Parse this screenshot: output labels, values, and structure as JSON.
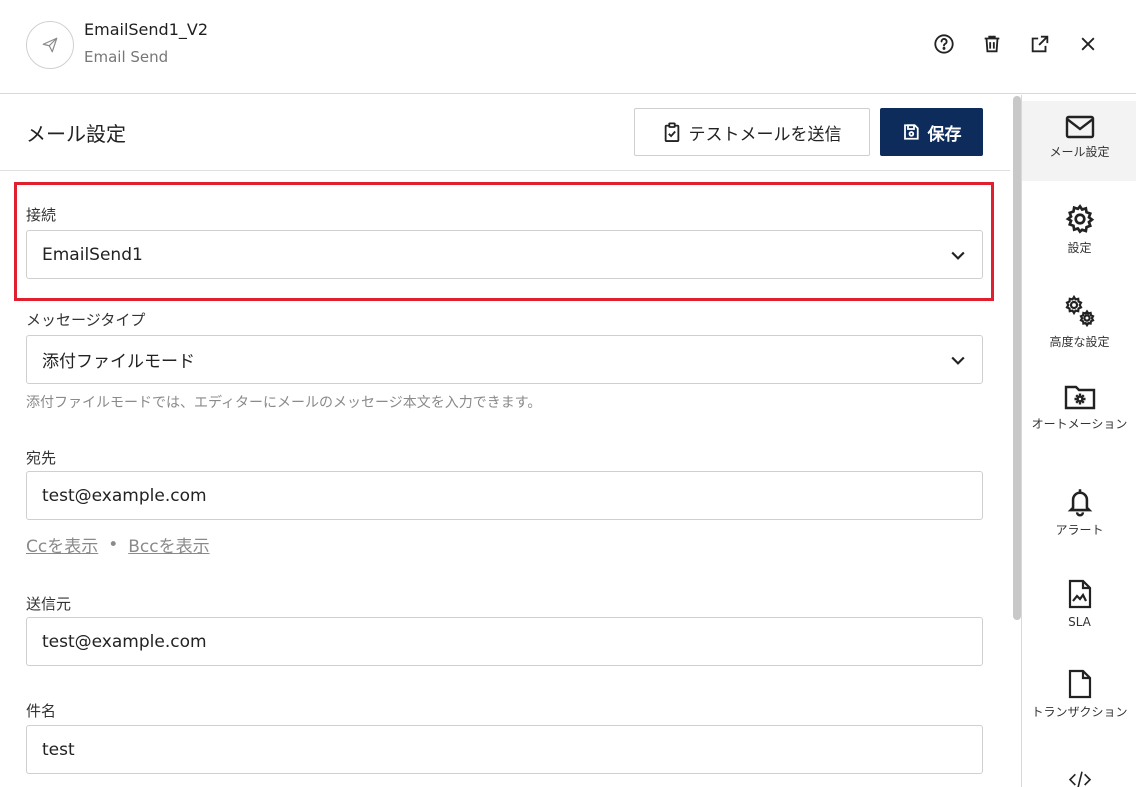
{
  "header": {
    "title": "EmailSend1_V2",
    "subtitle": "Email Send"
  },
  "section": {
    "title": "メール設定",
    "test_button": "テストメールを送信",
    "save_button": "保存"
  },
  "form": {
    "connection": {
      "label": "接続",
      "value": "EmailSend1"
    },
    "message_type": {
      "label": "メッセージタイプ",
      "value": "添付ファイルモード",
      "hint": "添付ファイルモードでは、エディターにメールのメッセージ本文を入力できます。"
    },
    "to": {
      "label": "宛先",
      "value": "test@example.com"
    },
    "cc_link": "Ccを表示",
    "separator": "•",
    "bcc_link": "Bccを表示",
    "from": {
      "label": "送信元",
      "value": "test@example.com"
    },
    "subject": {
      "label": "件名",
      "value": "test"
    }
  },
  "nav": [
    {
      "label": "メール設定",
      "icon": "mail-icon",
      "active": true
    },
    {
      "label": "設定",
      "icon": "gear-icon"
    },
    {
      "label": "高度な設定",
      "icon": "gears-icon"
    },
    {
      "label": "オートメーション",
      "icon": "folder-gear-icon"
    },
    {
      "label": "アラート",
      "icon": "bell-icon"
    },
    {
      "label": "SLA",
      "icon": "sla-document-icon"
    },
    {
      "label": "トランザクション",
      "icon": "document-icon"
    }
  ],
  "colors": {
    "primary": "#0d2b5b",
    "highlight": "#e0202e"
  }
}
